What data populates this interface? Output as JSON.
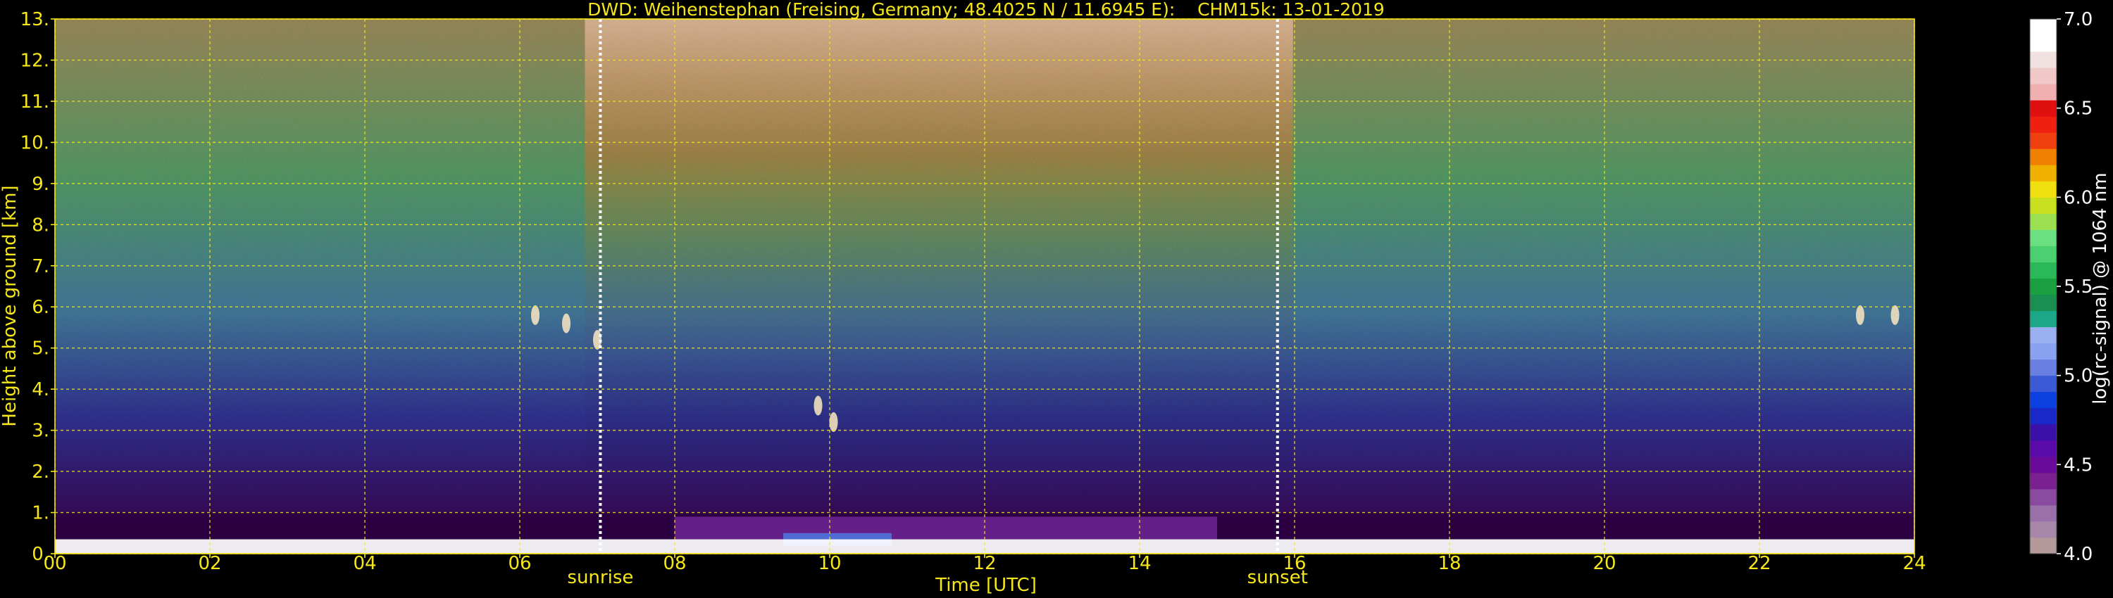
{
  "chart_data": {
    "type": "heatmap",
    "title": "DWD: Weihenstephan (Freising, Germany; 48.4025 N / 11.6945 E):    CHM15k: 13-01-2019",
    "xlabel": "Time [UTC]",
    "ylabel": "Height above ground [km]",
    "colorbar_label": "log(rc-signal) @ 1064 nm",
    "xlim": [
      0,
      24
    ],
    "ylim": [
      0,
      13
    ],
    "x_ticks": [
      0,
      2,
      4,
      6,
      8,
      10,
      12,
      14,
      16,
      18,
      20,
      22,
      24
    ],
    "x_tick_labels": [
      "00",
      "02",
      "04",
      "06",
      "08",
      "10",
      "12",
      "14",
      "16",
      "18",
      "20",
      "22",
      "24"
    ],
    "y_ticks": [
      0,
      1,
      2,
      3,
      4,
      5,
      6,
      7,
      8,
      9,
      10,
      11,
      12,
      13
    ],
    "y_tick_labels": [
      "0.",
      "1.",
      "2.",
      "3.",
      "4.",
      "5.",
      "6.",
      "7.",
      "8.",
      "9.",
      "10.",
      "11.",
      "12.",
      "13."
    ],
    "grid": true,
    "colorbar": {
      "range": [
        4.0,
        7.0
      ],
      "ticks": [
        4.0,
        4.5,
        5.0,
        5.5,
        6.0,
        6.5,
        7.0
      ],
      "tick_labels": [
        "4.0",
        "4.5",
        "5.0",
        "5.5",
        "6.0",
        "6.5",
        "7.0"
      ],
      "colors": [
        "#b49a9a",
        "#a888aa",
        "#9a70a8",
        "#8a4aa0",
        "#7a2090",
        "#6a0a9a",
        "#5a0aa8",
        "#3a10a8",
        "#1a28c8",
        "#0a40e0",
        "#3a5ad8",
        "#6a80e0",
        "#8aa0f0",
        "#9ab0f0",
        "#1aa888",
        "#1a9050",
        "#1aa040",
        "#2ab858",
        "#4ad070",
        "#6ae080",
        "#9ae050",
        "#c8e020",
        "#f0e010",
        "#f0b000",
        "#f08000",
        "#f04010",
        "#f02010",
        "#e01010",
        "#f0b0b0",
        "#f0c8c8",
        "#f0e0e0",
        "#ffffff",
        "#ffffff"
      ]
    },
    "vertical_markers": [
      {
        "label": "sunrise",
        "x": 7.04
      },
      {
        "label": "sunset",
        "x": 15.78
      }
    ],
    "cloud_features": [
      {
        "x": 6.2,
        "y": 5.8
      },
      {
        "x": 6.6,
        "y": 5.6
      },
      {
        "x": 7.0,
        "y": 5.2
      },
      {
        "x": 9.85,
        "y": 3.6
      },
      {
        "x": 10.05,
        "y": 3.2
      },
      {
        "x": 23.3,
        "y": 5.8
      },
      {
        "x": 23.75,
        "y": 5.8
      }
    ]
  }
}
